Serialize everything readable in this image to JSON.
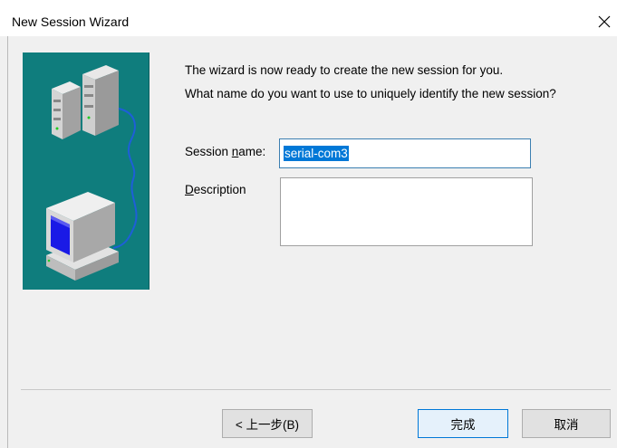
{
  "window": {
    "title": "New Session Wizard",
    "close_glyph": "✕"
  },
  "content": {
    "line1": "The wizard is now ready to create the new session for you.",
    "line2": "What name do you want to use to uniquely identify the new session?"
  },
  "form": {
    "session_name_label_pre": "Session ",
    "session_name_label_underlined": "n",
    "session_name_label_post": "ame:",
    "session_name_value": "serial-com3",
    "description_label_underlined": "D",
    "description_label_post": "escription",
    "description_value": ""
  },
  "buttons": {
    "back_label": "< 上一步(B)",
    "finish_label": "完成",
    "cancel_label": "取消"
  },
  "icons": {
    "illustration": "servers-connected-to-computer-illustration",
    "close": "close-icon"
  },
  "colors": {
    "illustration_bg": "#0f7d7d",
    "selection": "#0078d7"
  }
}
